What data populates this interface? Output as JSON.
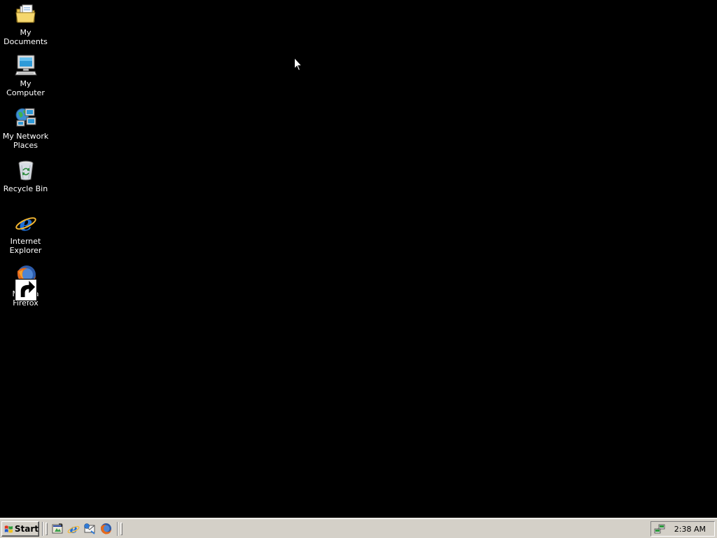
{
  "desktop": {
    "background_color": "#000000",
    "icons": [
      {
        "label": "My Documents",
        "icon": "folder-documents-icon"
      },
      {
        "label": "My Computer",
        "icon": "computer-icon"
      },
      {
        "label": "My Network Places",
        "icon": "network-places-icon"
      },
      {
        "label": "Recycle Bin",
        "icon": "recycle-bin-icon"
      },
      {
        "label": "Internet Explorer",
        "icon": "internet-explorer-icon"
      },
      {
        "label": "Mozilla Firefox",
        "icon": "firefox-icon"
      }
    ]
  },
  "taskbar": {
    "background_color": "#d4d0c8",
    "start_label": "Start",
    "quick_launch": [
      {
        "name": "show-desktop-icon"
      },
      {
        "name": "internet-explorer-icon"
      },
      {
        "name": "outlook-express-icon"
      },
      {
        "name": "firefox-icon"
      }
    ],
    "tray": {
      "icon": "network-connection-icon",
      "clock": "2:38 AM"
    }
  }
}
